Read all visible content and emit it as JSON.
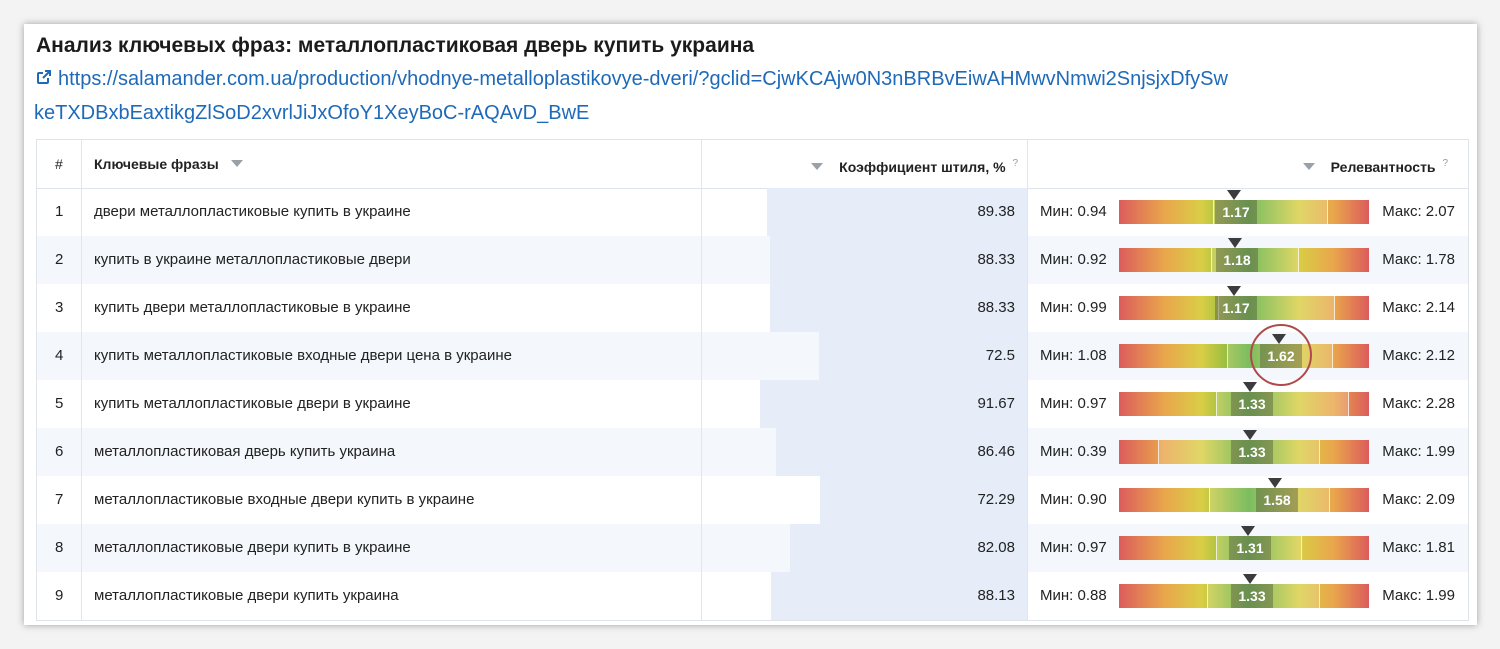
{
  "title": "Анализ ключевых фраз: металлопластиковая дверь купить украина",
  "url": "https://salamander.com.ua/production/vhodnye-metalloplastikovye-dveri/?gclid=CjwKCAjw0N3nBRBvEiwAHMwvNmwi2SnjsjxDfySwkeTXDBxbEaxtikgZlSoD2xvrlJiJxOfoY1XeyBoC-rAQAvD_BwE",
  "table": {
    "headers": {
      "num": "#",
      "keywords": "Ключевые фразы",
      "coefficient": "Коэффициент штиля, %",
      "coefficient_help": "?",
      "relevance": "Релевантность",
      "relevance_help": "?"
    },
    "rows": [
      {
        "num": "1",
        "keyword": "двери металлопластиковые купить в украине",
        "coef": "89.38",
        "min": "Мин: 0.94",
        "value": "1.17",
        "max": "Макс: 2.07",
        "coef_n": 89.38,
        "min_n": 0.94,
        "value_n": 1.17,
        "max_n": 2.07
      },
      {
        "num": "2",
        "keyword": "купить в украине металлопластиковые двери",
        "coef": "88.33",
        "min": "Мин: 0.92",
        "value": "1.18",
        "max": "Макс: 1.78",
        "coef_n": 88.33,
        "min_n": 0.92,
        "value_n": 1.18,
        "max_n": 1.78
      },
      {
        "num": "3",
        "keyword": "купить двери металлопластиковые в украине",
        "coef": "88.33",
        "min": "Мин: 0.99",
        "value": "1.17",
        "max": "Макс: 2.14",
        "coef_n": 88.33,
        "min_n": 0.99,
        "value_n": 1.17,
        "max_n": 2.14
      },
      {
        "num": "4",
        "keyword": "купить металлопластиковые входные двери цена в украине",
        "coef": "72.5",
        "min": "Мин: 1.08",
        "value": "1.62",
        "max": "Макс: 2.12",
        "coef_n": 72.5,
        "min_n": 1.08,
        "value_n": 1.62,
        "max_n": 2.12
      },
      {
        "num": "5",
        "keyword": "купить металлопластиковые двери в украине",
        "coef": "91.67",
        "min": "Мин: 0.97",
        "value": "1.33",
        "max": "Макс: 2.28",
        "coef_n": 91.67,
        "min_n": 0.97,
        "value_n": 1.33,
        "max_n": 2.28
      },
      {
        "num": "6",
        "keyword": "металлопластиковая дверь купить украина",
        "coef": "86.46",
        "min": "Мин: 0.39",
        "value": "1.33",
        "max": "Макс: 1.99",
        "coef_n": 86.46,
        "min_n": 0.39,
        "value_n": 1.33,
        "max_n": 1.99
      },
      {
        "num": "7",
        "keyword": "металлопластиковые входные двери купить в украине",
        "coef": "72.29",
        "min": "Мин: 0.90",
        "value": "1.58",
        "max": "Макс: 2.09",
        "coef_n": 72.29,
        "min_n": 0.9,
        "value_n": 1.58,
        "max_n": 2.09
      },
      {
        "num": "8",
        "keyword": "металлопластиковые двери купить в украине",
        "coef": "82.08",
        "min": "Мин: 0.97",
        "value": "1.31",
        "max": "Макс: 1.81",
        "coef_n": 82.08,
        "min_n": 0.97,
        "value_n": 1.31,
        "max_n": 1.81
      },
      {
        "num": "9",
        "keyword": "металлопластиковые двери купить украина",
        "coef": "88.13",
        "min": "Мин: 0.88",
        "value": "1.33",
        "max": "Макс: 1.99",
        "coef_n": 88.13,
        "min_n": 0.88,
        "value_n": 1.33,
        "max_n": 1.99
      }
    ]
  },
  "highlighted_row": 4,
  "icons": {
    "link": "external-link-icon",
    "sort": "sort-triangle-icon",
    "marker": "marker-triangle-icon"
  },
  "colors": {
    "link": "#1f6ab8",
    "bar": "#e6edf8",
    "highlight": "#b04a4a"
  }
}
